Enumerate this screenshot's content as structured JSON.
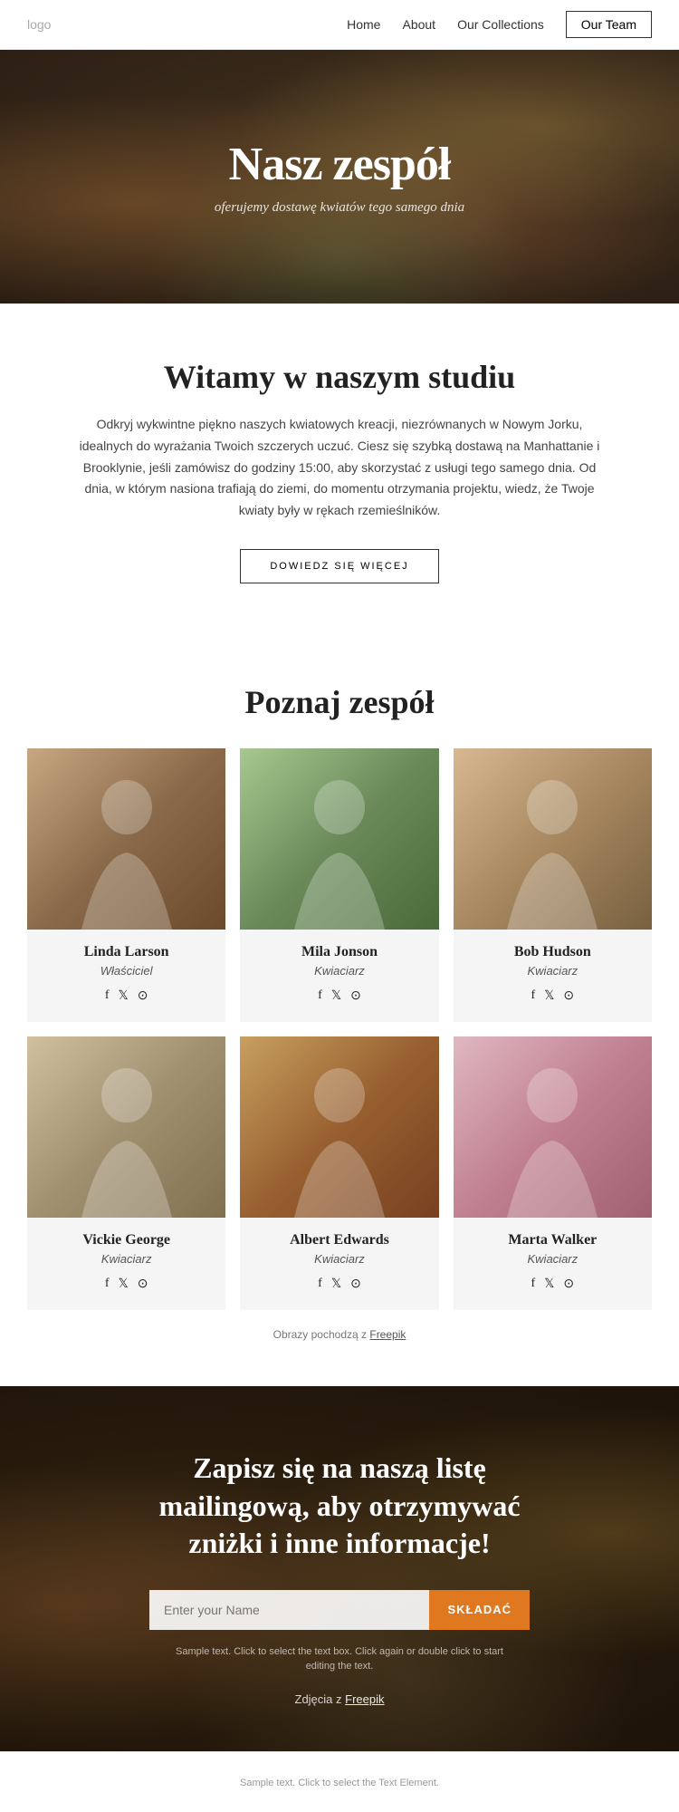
{
  "nav": {
    "logo": "logo",
    "links": [
      {
        "label": "Home",
        "href": "#"
      },
      {
        "label": "About",
        "href": "#"
      },
      {
        "label": "Our Collections",
        "href": "#"
      }
    ],
    "cta_label": "Our Team"
  },
  "hero": {
    "title": "Nasz zespół",
    "subtitle": "oferujemy dostawę kwiatów tego samego dnia"
  },
  "welcome": {
    "heading": "Witamy w naszym studiu",
    "body": "Odkryj wykwintne piękno naszych kwiatowych kreacji, niezrównanych w Nowym Jorku, idealnych do wyrażania Twoich szczerych uczuć. Ciesz się szybką dostawą na Manhattanie i Brooklynie, jeśli zamówisz do godziny 15:00, aby skorzystać z usługi tego samego dnia. Od dnia, w którym nasiona trafiają do ziemi, do momentu otrzymania projektu, wiedz, że Twoje kwiaty były w rękach rzemieślników.",
    "btn_label": "DOWIEDZ SIĘ WIĘCEJ"
  },
  "team": {
    "heading": "Poznaj zespół",
    "members": [
      {
        "name": "Linda Larson",
        "role": "Właściciel",
        "photo_class": "photo-1"
      },
      {
        "name": "Mila Jonson",
        "role": "Kwiaciarz",
        "photo_class": "photo-2"
      },
      {
        "name": "Bob Hudson",
        "role": "Kwiaciarz",
        "photo_class": "photo-3"
      },
      {
        "name": "Vickie George",
        "role": "Kwiaciarz",
        "photo_class": "photo-4"
      },
      {
        "name": "Albert Edwards",
        "role": "Kwiaciarz",
        "photo_class": "photo-5"
      },
      {
        "name": "Marta Walker",
        "role": "Kwiaciarz",
        "photo_class": "photo-6"
      }
    ],
    "freepik_note": "Obrazy pochodzą z ",
    "freepik_link": "Freepik"
  },
  "newsletter": {
    "heading": "Zapisz się na naszą listę mailingową, aby otrzymywać zniżki i inne informacje!",
    "input_placeholder": "Enter your Name",
    "btn_label": "SKŁADAĆ",
    "note": "Sample text. Click to select the text box. Click again or double click to start editing the text.",
    "photo_credit_text": "Zdjęcia z ",
    "photo_credit_link": "Freepik"
  },
  "footer": {
    "note": "Sample text. Click to select the Text Element."
  },
  "social_icons": {
    "facebook": "f",
    "twitter": "𝕏",
    "instagram": "⊙"
  }
}
